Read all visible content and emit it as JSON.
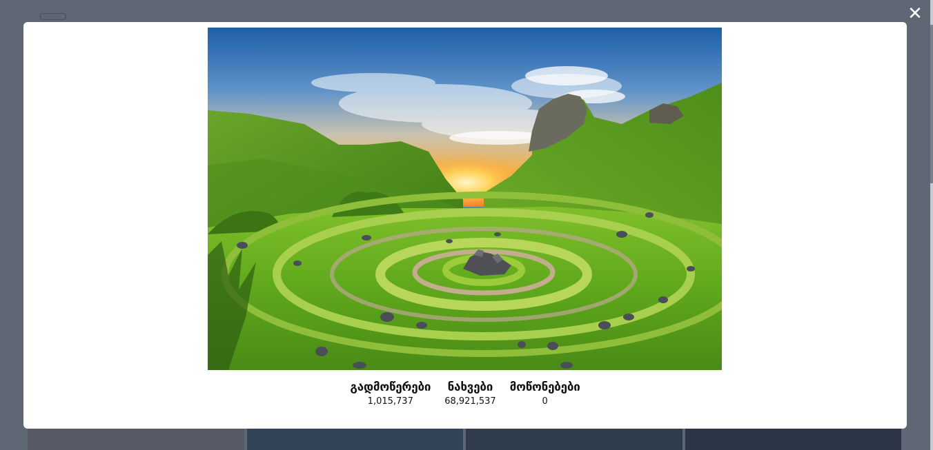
{
  "background_page": {
    "title": "",
    "button_label": "",
    "link_label": ""
  },
  "modal": {
    "close_icon": "close-icon",
    "image_alt": "",
    "stats": [
      {
        "label": "გადმოწერები",
        "value": "1,015,737"
      },
      {
        "label": "ნახვები",
        "value": "68,921,537"
      },
      {
        "label": "მოწონებები",
        "value": "0"
      }
    ]
  },
  "colors": {
    "overlay": "#263042",
    "modal_bg": "#ffffff",
    "text": "#111111"
  }
}
